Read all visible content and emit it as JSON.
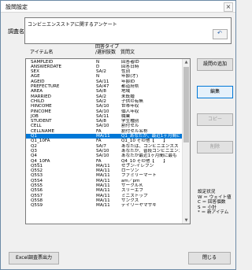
{
  "window": {
    "title": "設問設定",
    "close_glyph": "×"
  },
  "survey": {
    "label": "調査名",
    "value": "コンビニエンスストアに関するアンケート",
    "undo_glyph": "↶"
  },
  "list": {
    "headers": {
      "item": "アイテム名",
      "type": "回答タイプ\n/選択肢数",
      "question": "質問文"
    },
    "rows": [
      {
        "item": "SAMPLEID",
        "type": "N",
        "question": "回答者ID"
      },
      {
        "item": "ANSWERDATE",
        "type": "D",
        "question": "回答日時"
      },
      {
        "item": "SEX",
        "type": "SA/2",
        "question": "性別"
      },
      {
        "item": "AGE",
        "type": "N",
        "question": "年齢(才)"
      },
      {
        "item": "AGEID",
        "type": "SA/11",
        "question": "年齢ID"
      },
      {
        "item": "PREFECTURE",
        "type": "SA/47",
        "question": "都道府県"
      },
      {
        "item": "AREA",
        "type": "SA/8",
        "question": "地域"
      },
      {
        "item": "MARRIED",
        "type": "SA/2",
        "question": "未既婚"
      },
      {
        "item": "CHILD",
        "type": "SA/2",
        "question": "子供の有無"
      },
      {
        "item": "HINCOME",
        "type": "SA/10",
        "question": "世帯年収"
      },
      {
        "item": "PINCOME",
        "type": "SA/10",
        "question": "個人年収"
      },
      {
        "item": "JOB",
        "type": "SA/11",
        "question": "職業"
      },
      {
        "item": "STUDENT",
        "type": "SA/8",
        "question": "学生種別"
      },
      {
        "item": "CELL",
        "type": "SA/10",
        "question": "割付セル"
      },
      {
        "item": "CELLNAME",
        "type": "FA",
        "question": "割付セル名称"
      },
      {
        "item": "Q1",
        "type": "MA/11",
        "question": "Q1_あなたが、最近1ヶ月間に利"
      },
      {
        "item": "Q1_10FA",
        "type": "FA",
        "question": "Q1_10 その他【　　】"
      },
      {
        "item": "Q2",
        "type": "SA/7",
        "question": "あなたは、コンビニエンスストア"
      },
      {
        "item": "Q3",
        "type": "SA/10",
        "question": "あなたが、普段コンビニエンスス"
      },
      {
        "item": "Q4",
        "type": "SA/10",
        "question": "あなたが最近1ヶ月間に最も"
      },
      {
        "item": "Q4_10FA",
        "type": "FA",
        "question": "Q4_10 その他【　　】"
      },
      {
        "item": "Q5S1",
        "type": "MA/11",
        "question": "セブン-イレブン"
      },
      {
        "item": "Q5S2",
        "type": "MA/11",
        "question": "ローソン"
      },
      {
        "item": "Q5S3",
        "type": "MA/11",
        "question": "ファミリーマート"
      },
      {
        "item": "Q5S4",
        "type": "MA/11",
        "question": "am／pm"
      },
      {
        "item": "Q5S5",
        "type": "MA/11",
        "question": "サークルＫ"
      },
      {
        "item": "Q5S6",
        "type": "MA/11",
        "question": "スリーエフ"
      },
      {
        "item": "Q5S7",
        "type": "MA/11",
        "question": "ミニストップ"
      },
      {
        "item": "Q5S8",
        "type": "MA/11",
        "question": "サンクス"
      },
      {
        "item": "Q5S9",
        "type": "MA/11",
        "question": "デイリーヤマザキ"
      }
    ],
    "selected_index": 15
  },
  "buttons": {
    "add": "設問の追加",
    "edit": "編集",
    "copy": "コピー",
    "delete": "削除",
    "excel": "Excel調査票出力",
    "close": "閉じる"
  },
  "status": {
    "title": "設定状況",
    "lines": [
      "W ＝ ウェイト値",
      "C ＝ 回答個数",
      "S ＝ 小計",
      "* ＝ 新アイテム"
    ]
  }
}
